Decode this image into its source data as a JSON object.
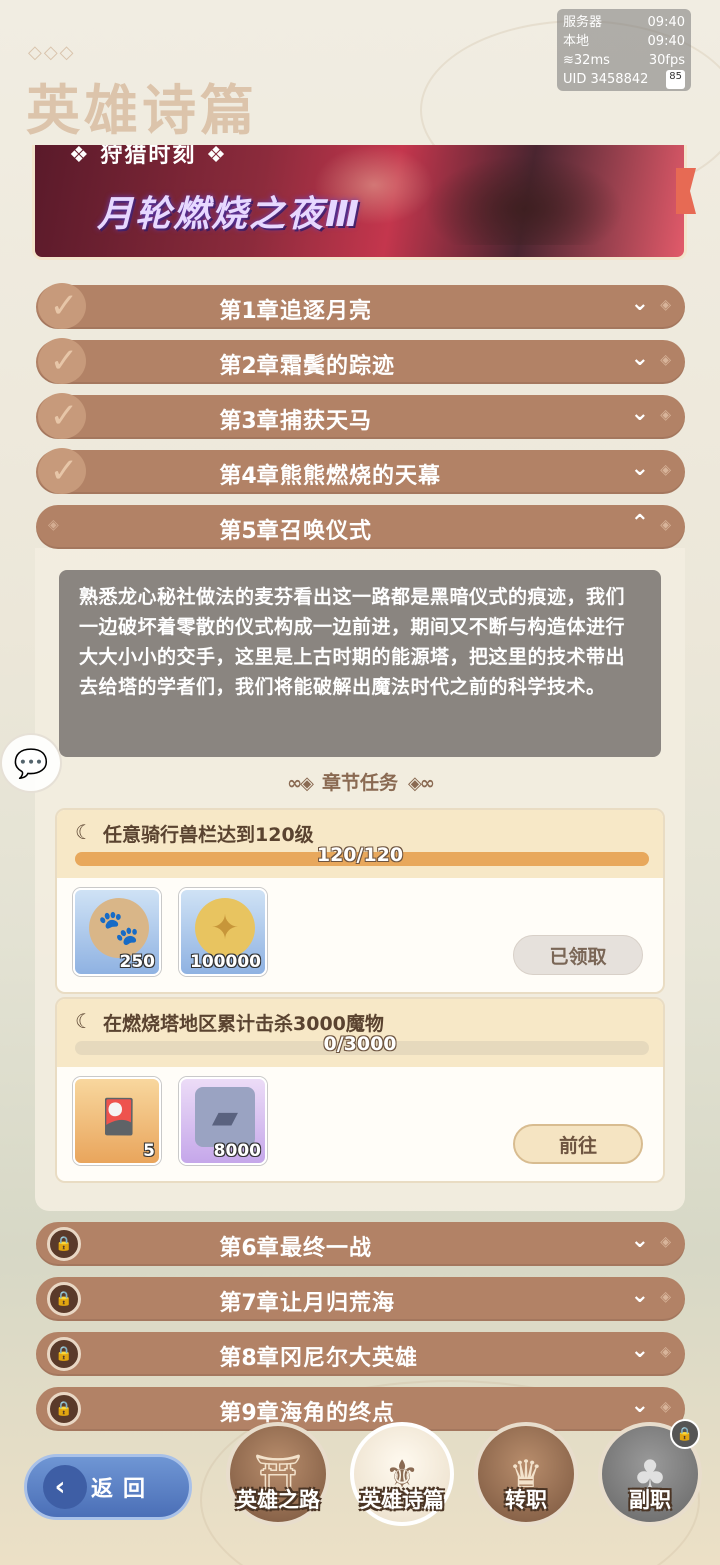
{
  "status": {
    "server_label": "服务器",
    "server_time": "09:40",
    "local_label": "本地",
    "local_time": "09:40",
    "ping": "32ms",
    "fps": "30fps",
    "uid": "UID 3458842",
    "uid_badge": "85"
  },
  "page": {
    "title": "英雄诗篇"
  },
  "banner": {
    "subtitle": "狩猎时刻",
    "title": "月轮燃烧之夜Ⅲ"
  },
  "chapters_top": [
    {
      "num": "第1章",
      "name": "追逐月亮",
      "toggle": "⌄",
      "state": "completed"
    },
    {
      "num": "第2章",
      "name": "霜鬓的踪迹",
      "toggle": "⌄",
      "state": "completed"
    },
    {
      "num": "第3章",
      "name": "捕获天马",
      "toggle": "⌄",
      "state": "completed"
    },
    {
      "num": "第4章",
      "name": "熊熊燃烧的天幕",
      "toggle": "⌄",
      "state": "completed"
    }
  ],
  "current_chapter": {
    "num": "第5章",
    "name": "召唤仪式",
    "toggle": "⌃",
    "description": "熟悉龙心秘社做法的麦芬看出这一路都是黑暗仪式的痕迹，我们一边破坏着零散的仪式构成一边前进，期间又不断与构造体进行大大小小的交手，这里是上古时期的能源塔，把这里的技术带出去给塔的学者们，我们将能破解出魔法时代之前的科学技术。",
    "section_title": "章节任务",
    "tasks": [
      {
        "name": "任意骑行兽栏达到120级",
        "progress_text": "120/120",
        "progress": 1.0,
        "rewards": [
          {
            "icon": "pet-food-bag-icon",
            "count": "250"
          },
          {
            "icon": "gold-coin-icon",
            "count": "100000"
          }
        ],
        "button": "已领取",
        "button_state": "claimed"
      },
      {
        "name": "在燃烧塔地区累计击杀3000魔物",
        "progress_text": "0/3000",
        "progress": 0.0,
        "rewards": [
          {
            "icon": "ticket-card-icon",
            "count": "5"
          },
          {
            "icon": "iron-ingot-icon",
            "count": "8000"
          }
        ],
        "button": "前往",
        "button_state": "go"
      }
    ]
  },
  "chapters_bottom": [
    {
      "num": "第6章",
      "name": "最终一战",
      "toggle": "⌄",
      "state": "locked"
    },
    {
      "num": "第7章",
      "name": "让月归荒海",
      "toggle": "⌄",
      "state": "locked"
    },
    {
      "num": "第8章",
      "name": "冈尼尔大英雄",
      "toggle": "⌄",
      "state": "locked"
    },
    {
      "num": "第9章",
      "name": "海角的终点",
      "toggle": "⌄",
      "state": "locked"
    }
  ],
  "nav": {
    "back": "返回",
    "items": [
      {
        "label": "英雄之路",
        "icon": "gate-icon"
      },
      {
        "label": "英雄诗篇",
        "icon": "helm-icon"
      },
      {
        "label": "转职",
        "icon": "crest-icon"
      },
      {
        "label": "副职",
        "icon": "tree-icon"
      }
    ]
  }
}
